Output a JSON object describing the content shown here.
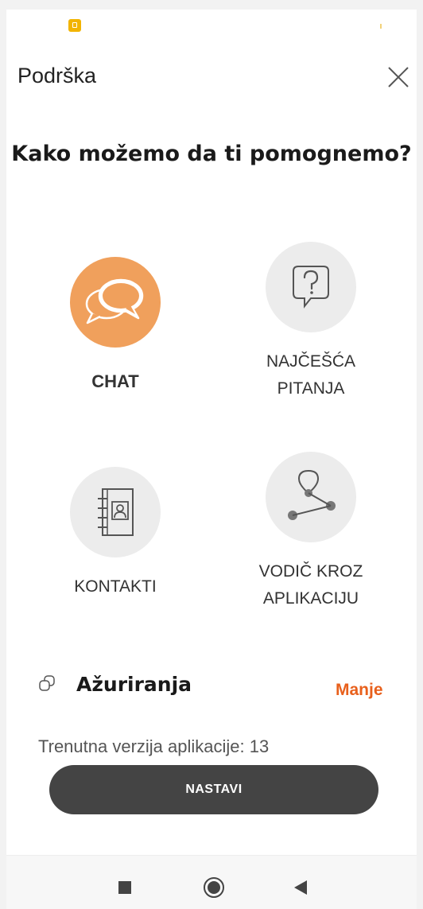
{
  "header": {
    "title": "Podrška"
  },
  "headline": "Kako možemo da ti pomognemo?",
  "options": [
    {
      "label": "CHAT",
      "icon": "chat-bubbles-icon",
      "active": true
    },
    {
      "label": "NAJČEŠĆA\nPITANJA",
      "icon": "question-bubble-icon",
      "active": false
    },
    {
      "label": "KONTAKTI",
      "icon": "address-book-icon",
      "active": false
    },
    {
      "label": "VODIČ KROZ\nAPLIKACIJU",
      "icon": "route-guide-icon",
      "active": false
    }
  ],
  "updates": {
    "title": "Ažuriranja",
    "toggle_label": "Manje",
    "version_text": "Trenutna verzija aplikacije: 13"
  },
  "continue_button": "NASTAVI",
  "colors": {
    "accent": "#f0a05c",
    "link": "#e8601c",
    "button": "#444444"
  }
}
